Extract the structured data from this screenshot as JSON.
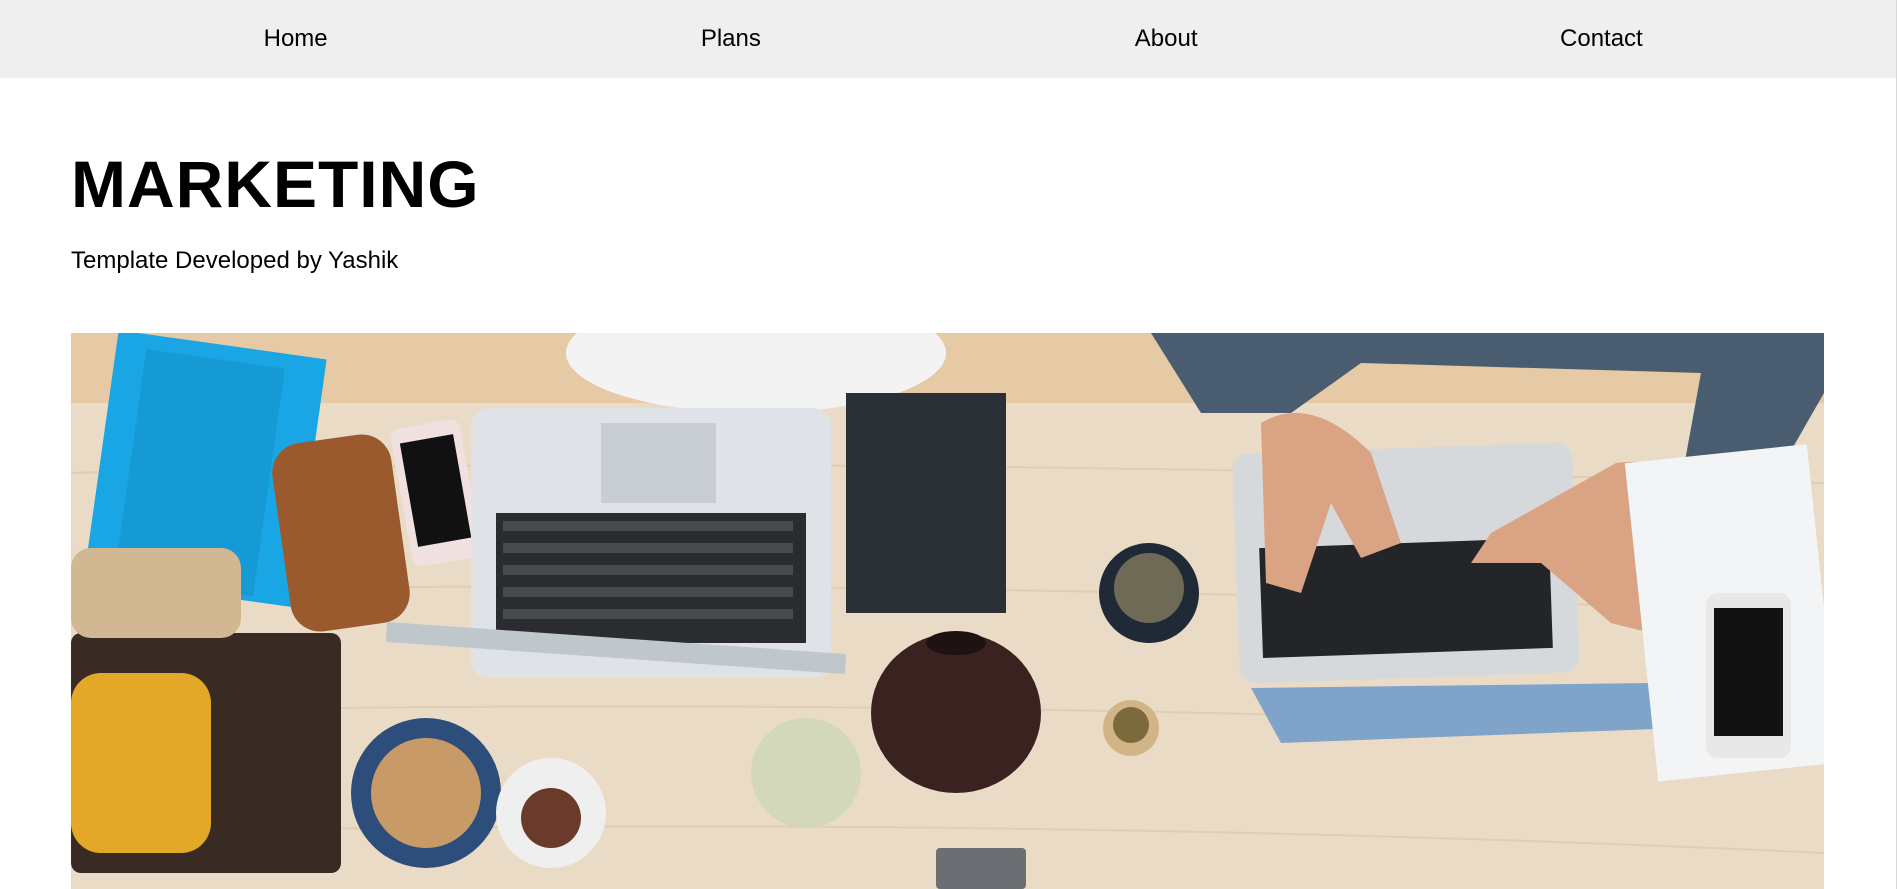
{
  "nav": {
    "items": [
      {
        "label": "Home"
      },
      {
        "label": "Plans"
      },
      {
        "label": "About"
      },
      {
        "label": "Contact"
      }
    ]
  },
  "header": {
    "title": "MARKETING",
    "subtitle": "Template Developed by Yashik"
  },
  "hero": {
    "subject": "desk-workspace-photo",
    "colors": {
      "table": "#e9d8c0",
      "laptop": "#d9dde2",
      "keys": "#2a2c30",
      "notebook_blue": "#19a9e6",
      "sweater": "#4a5d70",
      "skin": "#d9a384"
    }
  }
}
